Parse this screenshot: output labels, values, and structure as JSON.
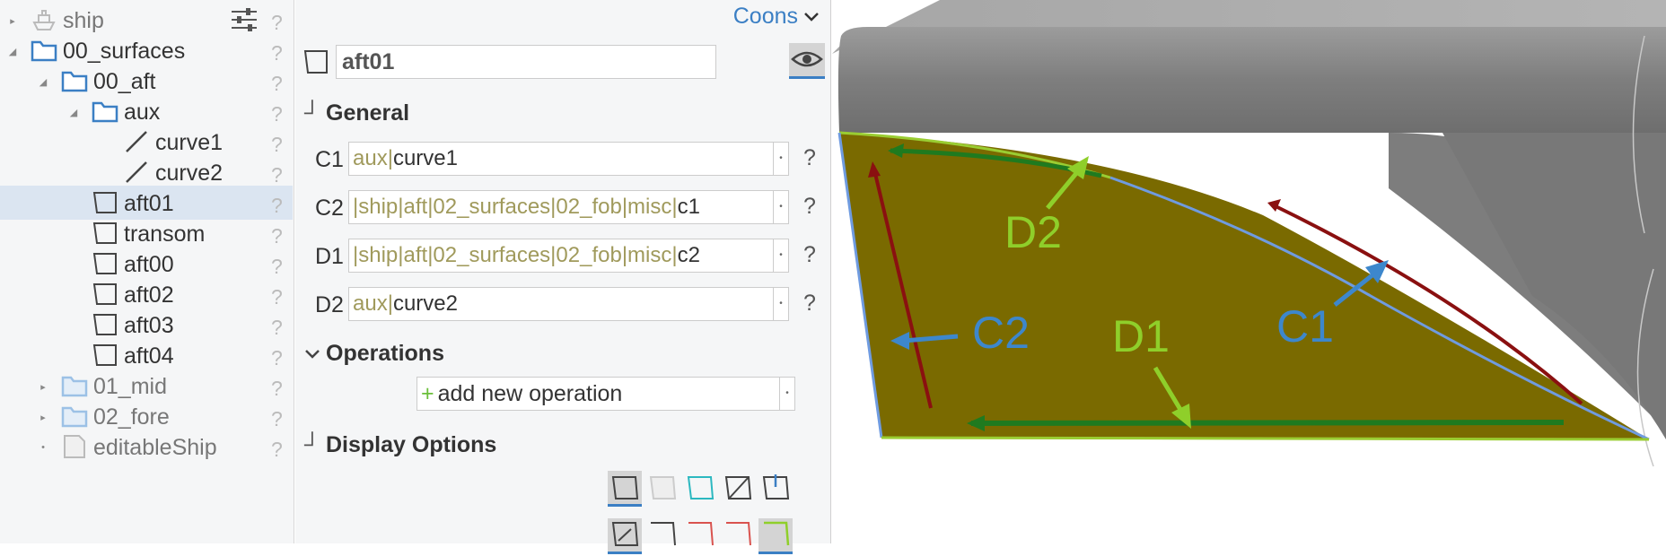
{
  "tree": {
    "items": [
      {
        "label": "ship",
        "icon": "ship-icon",
        "expand": "collapsed",
        "level": 0,
        "dim": true
      },
      {
        "label": "00_surfaces",
        "icon": "folder-icon",
        "expand": "expanded",
        "level": 0
      },
      {
        "label": "00_aft",
        "icon": "folder-icon",
        "expand": "expanded",
        "level": 1
      },
      {
        "label": "aux",
        "icon": "folder-icon",
        "expand": "expanded",
        "level": 2
      },
      {
        "label": "curve1",
        "icon": "curve-icon",
        "level": 3
      },
      {
        "label": "curve2",
        "icon": "curve-icon",
        "level": 3
      },
      {
        "label": "aft01",
        "icon": "surface-icon",
        "level": 2,
        "selected": true
      },
      {
        "label": "transom",
        "icon": "surface-icon",
        "level": 2
      },
      {
        "label": "aft00",
        "icon": "surface-icon",
        "level": 2
      },
      {
        "label": "aft02",
        "icon": "surface-icon",
        "level": 2
      },
      {
        "label": "aft03",
        "icon": "surface-icon",
        "level": 2
      },
      {
        "label": "aft04",
        "icon": "surface-icon",
        "level": 2
      },
      {
        "label": "01_mid",
        "icon": "folder-icon",
        "expand": "collapsed",
        "level": 1,
        "dim": true
      },
      {
        "label": "02_fore",
        "icon": "folder-icon",
        "expand": "collapsed",
        "level": 1,
        "dim": true
      },
      {
        "label": "editableShip",
        "icon": "file-icon",
        "expand": "leaf",
        "level": 1,
        "dim": true
      }
    ],
    "help": "?"
  },
  "props": {
    "type": "Coons",
    "name": "aft01",
    "general": "General",
    "fields": [
      {
        "label": "C1",
        "parts": [
          "aux"
        ],
        "last": "curve1",
        "help": "?"
      },
      {
        "label": "C2",
        "parts": [
          "",
          "ship",
          "aft",
          "02_surfaces",
          "02_fob",
          "misc"
        ],
        "last": "c1",
        "help": "?"
      },
      {
        "label": "D1",
        "parts": [
          "",
          "ship",
          "aft",
          "02_surfaces",
          "02_fob",
          "misc"
        ],
        "last": "c2",
        "help": "?"
      },
      {
        "label": "D2",
        "parts": [
          "aux"
        ],
        "last": "curve2",
        "help": "?"
      }
    ],
    "operations": "Operations",
    "add_op": "add new operation",
    "display": "Display Options"
  },
  "viewport": {
    "labels": {
      "c1": "C1",
      "c2": "C2",
      "d1": "D1",
      "d2": "D2"
    },
    "colors": {
      "surface": "#7a6a00",
      "green_label": "#8fcf2a",
      "blue_label": "#3d87cc",
      "arrow_red": "#8a1010",
      "arrow_green": "#1f7a1f",
      "hull": "#8a8a8a"
    }
  }
}
